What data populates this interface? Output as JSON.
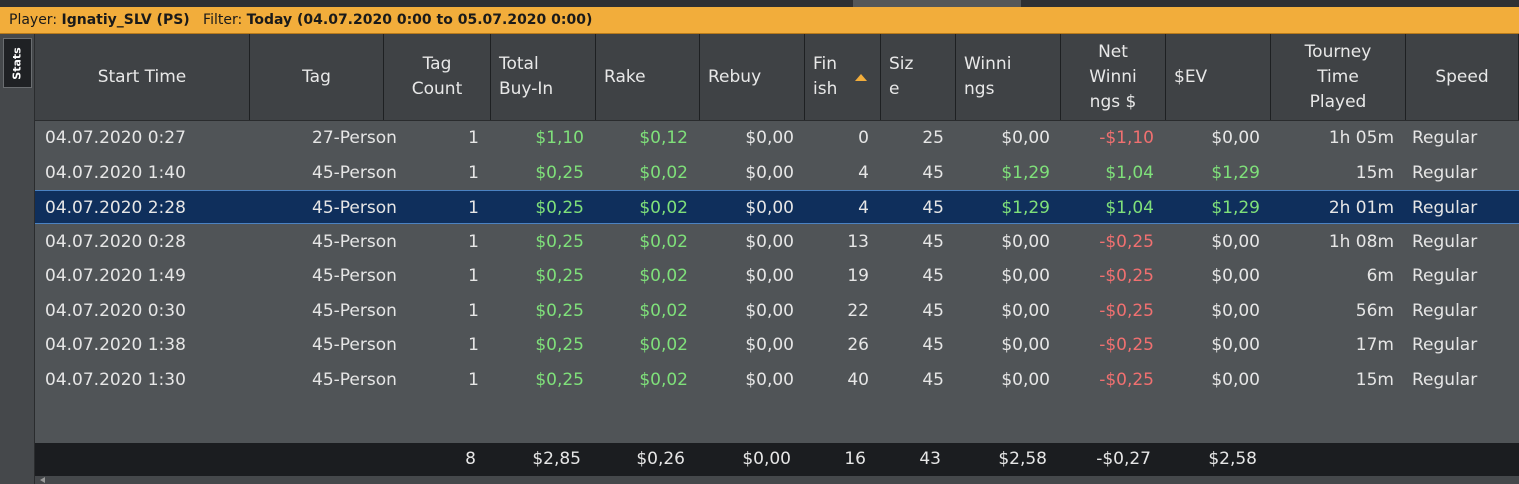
{
  "filter_bar": {
    "player_label": "Player:",
    "player_value": "Ignatiy_SLV (PS)",
    "filter_label": "Filter:",
    "filter_value": "Today (04.07.2020 0:00 to 05.07.2020 0:00)"
  },
  "side_tab_label": "Stats",
  "columns": [
    [
      "Start Time"
    ],
    [
      "Tag"
    ],
    [
      "Tag",
      "Count"
    ],
    [
      "Total",
      "Buy-In"
    ],
    [
      "Rake"
    ],
    [
      "Rebuy"
    ],
    [
      "Fin",
      "ish"
    ],
    [
      "Siz",
      "e"
    ],
    [
      "Winni",
      "ngs"
    ],
    [
      "Net",
      "Winni",
      "ngs $"
    ],
    [
      "$EV"
    ],
    [
      "Tourney",
      "Time",
      "Played"
    ],
    [
      "Speed"
    ]
  ],
  "sorted_column": "Finish",
  "rows": [
    {
      "start": "04.07.2020 0:27",
      "tag": "27-Person",
      "count": "1",
      "buyin": "$1,10",
      "rake": "$0,12",
      "rebuy": "$0,00",
      "finish": "0",
      "size": "25",
      "winnings": "$0,00",
      "net": "-$1,10",
      "ev": "$0,00",
      "time": "1h 05m",
      "speed": "Regular",
      "selected": false
    },
    {
      "start": "04.07.2020 1:40",
      "tag": "45-Person",
      "count": "1",
      "buyin": "$0,25",
      "rake": "$0,02",
      "rebuy": "$0,00",
      "finish": "4",
      "size": "45",
      "winnings": "$1,29",
      "net": "$1,04",
      "ev": "$1,29",
      "time": "15m",
      "speed": "Regular",
      "selected": false
    },
    {
      "start": "04.07.2020 2:28",
      "tag": "45-Person",
      "count": "1",
      "buyin": "$0,25",
      "rake": "$0,02",
      "rebuy": "$0,00",
      "finish": "4",
      "size": "45",
      "winnings": "$1,29",
      "net": "$1,04",
      "ev": "$1,29",
      "time": "2h 01m",
      "speed": "Regular",
      "selected": true
    },
    {
      "start": "04.07.2020 0:28",
      "tag": "45-Person",
      "count": "1",
      "buyin": "$0,25",
      "rake": "$0,02",
      "rebuy": "$0,00",
      "finish": "13",
      "size": "45",
      "winnings": "$0,00",
      "net": "-$0,25",
      "ev": "$0,00",
      "time": "1h 08m",
      "speed": "Regular",
      "selected": false
    },
    {
      "start": "04.07.2020 1:49",
      "tag": "45-Person",
      "count": "1",
      "buyin": "$0,25",
      "rake": "$0,02",
      "rebuy": "$0,00",
      "finish": "19",
      "size": "45",
      "winnings": "$0,00",
      "net": "-$0,25",
      "ev": "$0,00",
      "time": "6m",
      "speed": "Regular",
      "selected": false
    },
    {
      "start": "04.07.2020 0:30",
      "tag": "45-Person",
      "count": "1",
      "buyin": "$0,25",
      "rake": "$0,02",
      "rebuy": "$0,00",
      "finish": "22",
      "size": "45",
      "winnings": "$0,00",
      "net": "-$0,25",
      "ev": "$0,00",
      "time": "56m",
      "speed": "Regular",
      "selected": false
    },
    {
      "start": "04.07.2020 1:38",
      "tag": "45-Person",
      "count": "1",
      "buyin": "$0,25",
      "rake": "$0,02",
      "rebuy": "$0,00",
      "finish": "26",
      "size": "45",
      "winnings": "$0,00",
      "net": "-$0,25",
      "ev": "$0,00",
      "time": "17m",
      "speed": "Regular",
      "selected": false
    },
    {
      "start": "04.07.2020 1:30",
      "tag": "45-Person",
      "count": "1",
      "buyin": "$0,25",
      "rake": "$0,02",
      "rebuy": "$0,00",
      "finish": "40",
      "size": "45",
      "winnings": "$0,00",
      "net": "-$0,25",
      "ev": "$0,00",
      "time": "15m",
      "speed": "Regular",
      "selected": false
    }
  ],
  "totals": {
    "count": "8",
    "buyin": "$2,85",
    "rake": "$0,26",
    "rebuy": "$0,00",
    "finish": "16",
    "size": "43",
    "winnings": "$2,58",
    "net": "-$0,27",
    "ev": "$2,58"
  },
  "colors": {
    "filter_bar": "#f2ad3b",
    "selected_row": "#0f2f5c",
    "positive": "#7fe07a",
    "negative": "#f07070",
    "sort_arrow": "#f2ad3b"
  }
}
